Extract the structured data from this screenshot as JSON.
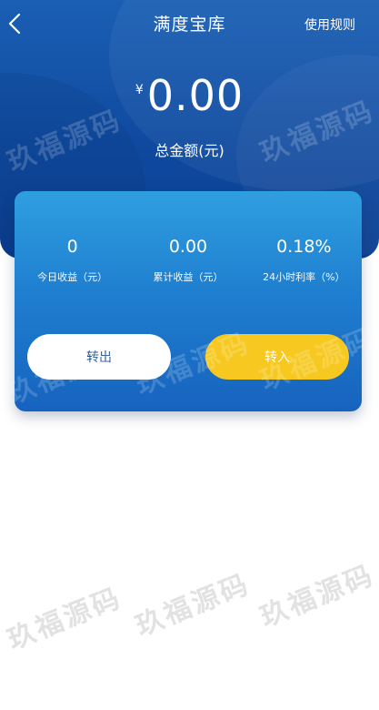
{
  "nav": {
    "title": "满度宝库",
    "rules_label": "使用规则"
  },
  "balance": {
    "currency_symbol": "¥",
    "amount": "0.00",
    "label": "总金额(元)"
  },
  "stats": [
    {
      "value": "0",
      "label": "今日收益（元）"
    },
    {
      "value": "0.00",
      "label": "累计收益（元）"
    },
    {
      "value": "0.18%",
      "label": "24小时利率（%）"
    }
  ],
  "actions": {
    "transfer_out_label": "转出",
    "transfer_in_label": "转入"
  },
  "watermark": {
    "text": "玖福源码"
  },
  "colors": {
    "header_blue": "#1258b0",
    "card_blue": "#2a8fdb",
    "accent_yellow": "#f7c81f",
    "text_white": "#ffffff"
  },
  "icons": {
    "back": "chevron-left-icon"
  }
}
